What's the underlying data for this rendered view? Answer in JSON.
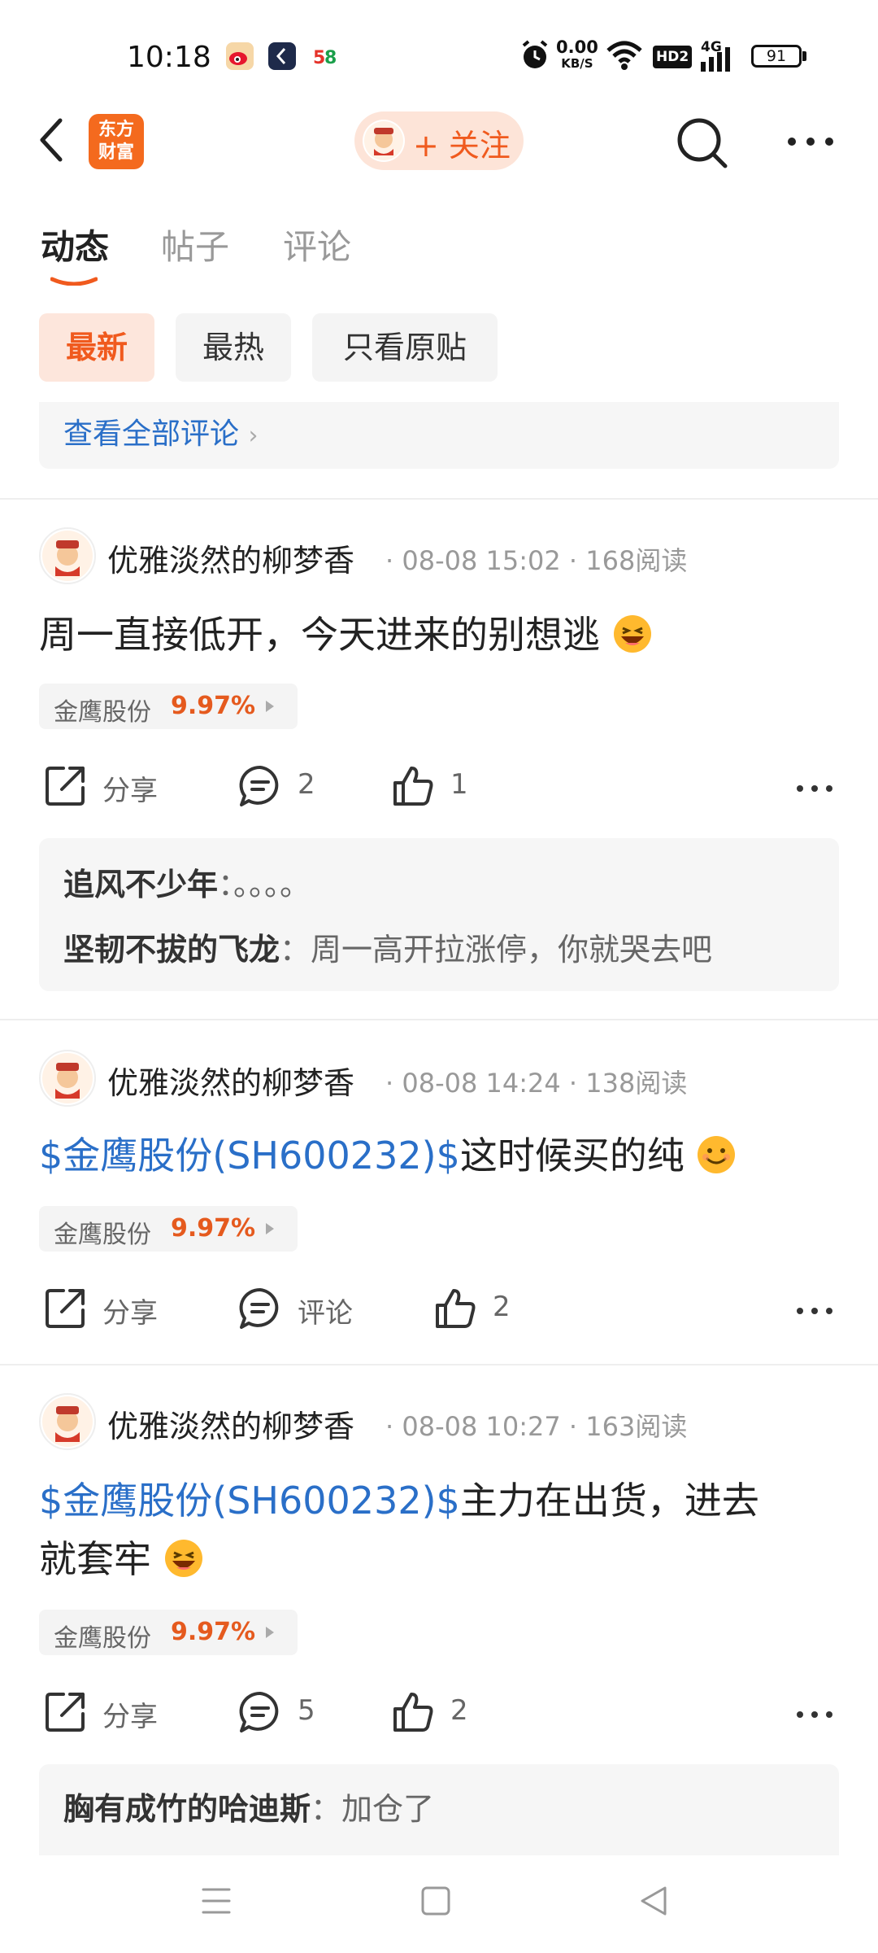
{
  "status_bar": {
    "time": "10:18",
    "net_speed_value": "0.00",
    "net_speed_unit": "KB/S",
    "hd_label": "HD2",
    "signal_label": "4G",
    "battery": "91"
  },
  "header": {
    "logo_line1": "东方",
    "logo_line2": "财富",
    "follow_label": "+ 关注"
  },
  "tabs": [
    {
      "label": "动态",
      "active": true
    },
    {
      "label": "帖子",
      "active": false
    },
    {
      "label": "评论",
      "active": false
    }
  ],
  "filters": [
    {
      "label": "最新",
      "active": true
    },
    {
      "label": "最热",
      "active": false
    },
    {
      "label": "只看原贴",
      "active": false
    }
  ],
  "view_all_comments": "查看全部评论",
  "posts": [
    {
      "author": "优雅淡然的柳梦香",
      "meta": "· 08-08 15:02 · 168阅读",
      "text": "周一直接低开，今天进来的别想逃",
      "stock_name": "金鹰股份",
      "stock_pct": "9.97%",
      "share_label": "分享",
      "comment_label": "2",
      "like_label": "1",
      "comments": [
        {
          "name": "追风不少年",
          "text": "。。。。"
        },
        {
          "name": "坚韧不拔的飞龙",
          "text": "周一高开拉涨停，你就哭去吧"
        }
      ]
    },
    {
      "author": "优雅淡然的柳梦香",
      "meta": "· 08-08 14:24 · 138阅读",
      "link": "$金鹰股份(SH600232)$",
      "text": "这时候买的纯",
      "stock_name": "金鹰股份",
      "stock_pct": "9.97%",
      "share_label": "分享",
      "comment_label": "评论",
      "like_label": "2"
    },
    {
      "author": "优雅淡然的柳梦香",
      "meta": "· 08-08 10:27 · 163阅读",
      "link": "$金鹰股份(SH600232)$",
      "text": "主力在出货，进去",
      "text_line2": "就套牢",
      "stock_name": "金鹰股份",
      "stock_pct": "9.97%",
      "share_label": "分享",
      "comment_label": "5",
      "like_label": "2",
      "comments": [
        {
          "name": "胸有成竹的哈迪斯",
          "text": "加仓了"
        }
      ]
    }
  ],
  "colors": {
    "accent": "#f05a1e",
    "link": "#2a6fc8"
  }
}
